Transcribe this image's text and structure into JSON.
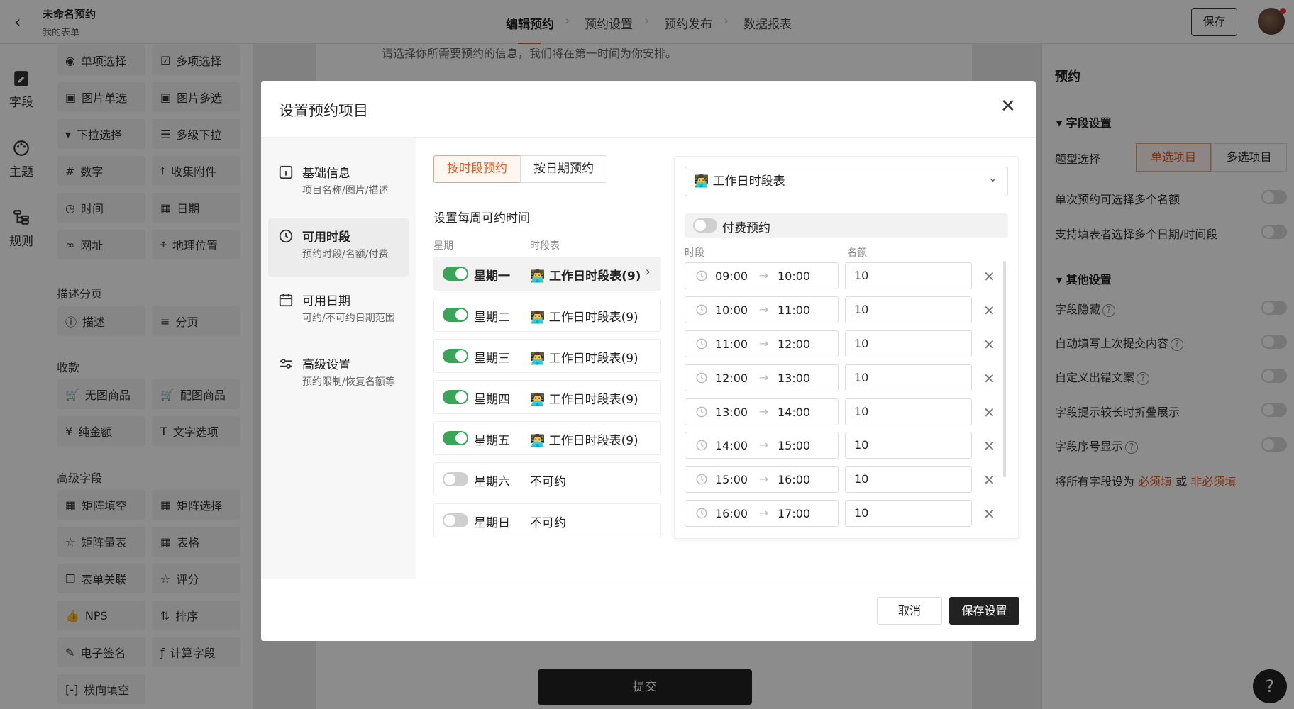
{
  "header": {
    "title": "未命名预约",
    "subtitle": "我的表单",
    "nav": [
      "编辑预约",
      "预约设置",
      "预约发布",
      "数据报表"
    ],
    "save_label": "保存"
  },
  "rail": {
    "items": [
      "字段",
      "主题",
      "规则"
    ]
  },
  "fields": {
    "basic": [
      "单项选择",
      "多项选择",
      "图片单选",
      "图片多选",
      "下拉选择",
      "多级下拉",
      "数字",
      "收集附件",
      "时间",
      "日期",
      "网址",
      "地理位置"
    ],
    "desc_title": "描述分页",
    "desc": [
      "描述",
      "分页"
    ],
    "pay_title": "收款",
    "pay": [
      "无图商品",
      "配图商品",
      "纯金额",
      "文字选项"
    ],
    "adv_title": "高级字段",
    "adv": [
      "矩阵填空",
      "矩阵选择",
      "矩阵量表",
      "表格",
      "表单关联",
      "评分",
      "NPS",
      "排序",
      "电子签名",
      "计算字段",
      "横向填空"
    ]
  },
  "canvas": {
    "intro_text": "请选择你所需要预约的信息，我们将在第一时间为你安排。",
    "submit_label": "提交"
  },
  "right_panel": {
    "title": "预约",
    "field_settings": "字段设置",
    "type_label": "题型选择",
    "type_options": [
      "单选项目",
      "多选项目"
    ],
    "multi_quota": "单次预约可选择多个名额",
    "multi_date": "支持填表者选择多个日期/时间段",
    "other_settings": "其他设置",
    "hide_field": "字段隐藏",
    "autofill": "自动填写上次提交内容",
    "custom_error": "自定义出错文案",
    "collapse_hint": "字段提示较长时折叠展示",
    "show_index": "字段序号显示",
    "set_all_prefix": "将所有字段设为",
    "required": "必须填",
    "or": "或",
    "not_required": "非必须填"
  },
  "modal": {
    "title": "设置预约项目",
    "nav": [
      {
        "title": "基础信息",
        "sub": "项目名称/图片/描述"
      },
      {
        "title": "可用时段",
        "sub": "预约时段/名额/付费"
      },
      {
        "title": "可用日期",
        "sub": "可约/不可约日期范围"
      },
      {
        "title": "高级设置",
        "sub": "预约限制/恢复名额等"
      }
    ],
    "tabs": [
      "按时段预约",
      "按日期预约"
    ],
    "section_label": "设置每周可约时间",
    "col_week": "星期",
    "col_table": "时段表",
    "days": [
      {
        "name": "星期一",
        "value": "👨‍💻 工作日时段表(9)",
        "on": true
      },
      {
        "name": "星期二",
        "value": "👨‍💻 工作日时段表(9)",
        "on": true
      },
      {
        "name": "星期三",
        "value": "👨‍💻 工作日时段表(9)",
        "on": true
      },
      {
        "name": "星期四",
        "value": "👨‍💻 工作日时段表(9)",
        "on": true
      },
      {
        "name": "星期五",
        "value": "👨‍💻 工作日时段表(9)",
        "on": true
      },
      {
        "name": "星期六",
        "value": "不可约",
        "on": false
      },
      {
        "name": "星期日",
        "value": "不可约",
        "on": false
      }
    ],
    "selected_table": "👨‍💻 工作日时段表",
    "paid_label": "付费预约",
    "col_slot": "时段",
    "col_quota": "名额",
    "slots": [
      {
        "start": "09:00",
        "end": "10:00",
        "quota": "10"
      },
      {
        "start": "10:00",
        "end": "11:00",
        "quota": "10"
      },
      {
        "start": "11:00",
        "end": "12:00",
        "quota": "10"
      },
      {
        "start": "12:00",
        "end": "13:00",
        "quota": "10"
      },
      {
        "start": "13:00",
        "end": "14:00",
        "quota": "10"
      },
      {
        "start": "14:00",
        "end": "15:00",
        "quota": "10"
      },
      {
        "start": "15:00",
        "end": "16:00",
        "quota": "10"
      },
      {
        "start": "16:00",
        "end": "17:00",
        "quota": "10"
      }
    ],
    "cancel_label": "取消",
    "save_label": "保存设置"
  },
  "colors": {
    "accent": "#e65a1e",
    "toggle_on": "#3aa558",
    "dark": "#222222"
  }
}
